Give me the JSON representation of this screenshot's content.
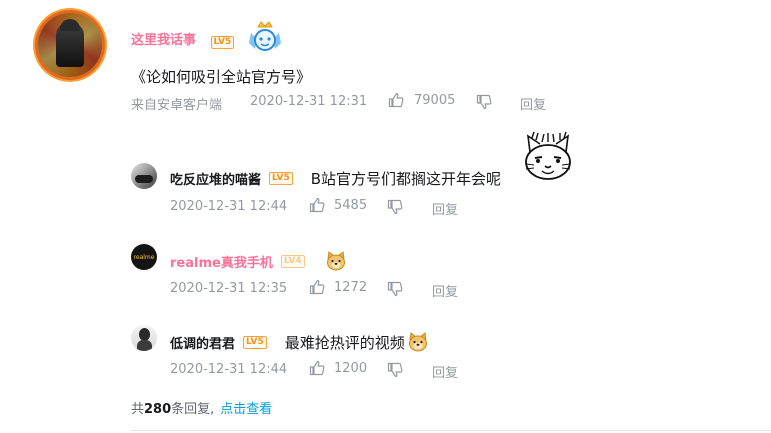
{
  "main_comment": {
    "username": "这里我话事",
    "level": "LV5",
    "text": "《论如何吸引全站官方号》",
    "source": "来自安卓客户端",
    "time": "2020-12-31 12:31",
    "likes": "79005",
    "reply_label": "回复"
  },
  "replies": [
    {
      "username": "吃反应堆的喵酱",
      "level": "LV5",
      "text": "B站官方号们都搁这开年会呢",
      "time": "2020-12-31 12:44",
      "likes": "5485",
      "reply_label": "回复"
    },
    {
      "username": "realme真我手机",
      "level": "LV4",
      "avatar_text": "realme",
      "text": "",
      "time": "2020-12-31 12:35",
      "likes": "1272",
      "reply_label": "回复"
    },
    {
      "username": "低调的君君",
      "level": "LV5",
      "text": "最难抢热评的视频",
      "time": "2020-12-31 12:44",
      "likes": "1200",
      "reply_label": "回复"
    }
  ],
  "footer": {
    "prefix": "共",
    "count": "280",
    "suffix": "条回复,",
    "link": "点击查看"
  },
  "colors": {
    "vip_name": "#fb7299",
    "meta": "#9499a0",
    "link": "#00a1d6",
    "level": "#f29321"
  }
}
